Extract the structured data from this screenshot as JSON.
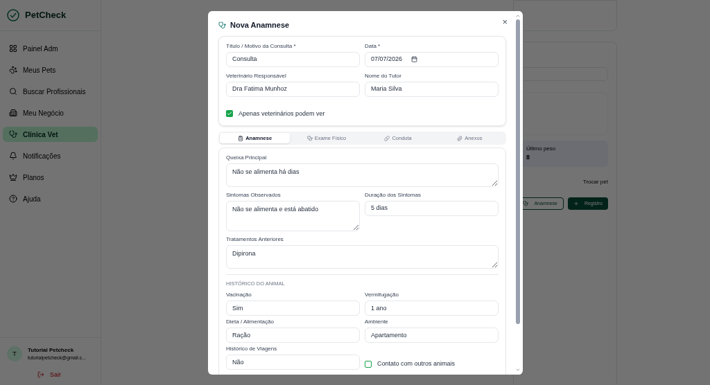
{
  "sidebar": {
    "brand": "PetCheck",
    "items": [
      {
        "label": "Painel Adm",
        "selected": false
      },
      {
        "label": "Meus Pets",
        "selected": false
      },
      {
        "label": "Buscar Profissionais",
        "selected": false
      },
      {
        "label": "Meu Negócio",
        "selected": false
      },
      {
        "label": "Clínica Vet",
        "selected": true
      },
      {
        "label": "Notificações",
        "selected": false
      },
      {
        "label": "Planos",
        "selected": false
      },
      {
        "label": "Ajuda",
        "selected": false
      }
    ],
    "user": {
      "initial": "T",
      "name": "Tutorial Petcheck",
      "email": "tutorialpetcheck@gmail.c..."
    },
    "logout": "Sair"
  },
  "background": {
    "stat_label": "Último peso",
    "stat_value": "8",
    "switch_link": "Trocar pet",
    "buttons": [
      {
        "kind": "outline",
        "label": "Anamnese"
      },
      {
        "kind": "primary",
        "label": "Registro"
      }
    ]
  },
  "modal": {
    "title": "Nova Anamnese",
    "close": "×",
    "header_fields": [
      {
        "kind": "text",
        "label": "Título / Motivo da Consulta *",
        "value": "Consulta"
      },
      {
        "kind": "date",
        "label": "Data *",
        "value": "07/07/2026"
      },
      {
        "kind": "text",
        "label": "Veterinário Responsável",
        "value": "Dra Fatima Munhoz"
      },
      {
        "kind": "text",
        "label": "Nome do Tutor",
        "value": "Maria Silva"
      }
    ],
    "private_checkbox": {
      "label": "Apenas veterinários podem ver",
      "checked": true
    },
    "tabs": [
      {
        "label": "Anamnese",
        "selected": true
      },
      {
        "label": "Exame Físico",
        "selected": false
      },
      {
        "label": "Conduta",
        "selected": false
      },
      {
        "label": "Anexos",
        "selected": false
      }
    ],
    "complaint": {
      "label": "Queixa Principal",
      "value": "Não se alimenta há dias"
    },
    "symptoms": {
      "label": "Sintomas Observados",
      "value": "Não se alimenta e está abatido"
    },
    "duration": {
      "label": "Duração dos Sintomas",
      "value": "5 dias"
    },
    "treatments": {
      "label": "Tratamentos Anteriores",
      "value": "Dipirona"
    },
    "history_title": "HISTÓRICO DO ANIMAL",
    "history_fields": [
      {
        "label": "Vacinação",
        "value": "Sim"
      },
      {
        "label": "Vermifugação",
        "value": "1 ano"
      },
      {
        "label": "Dieta / Alimentação",
        "value": "Ração"
      },
      {
        "label": "Ambiente",
        "value": "Apartamento"
      },
      {
        "label": "Histórico de Viagens",
        "value": "Não"
      }
    ],
    "contact_checkbox": {
      "label": "Contato com outros animais",
      "checked": false
    }
  }
}
